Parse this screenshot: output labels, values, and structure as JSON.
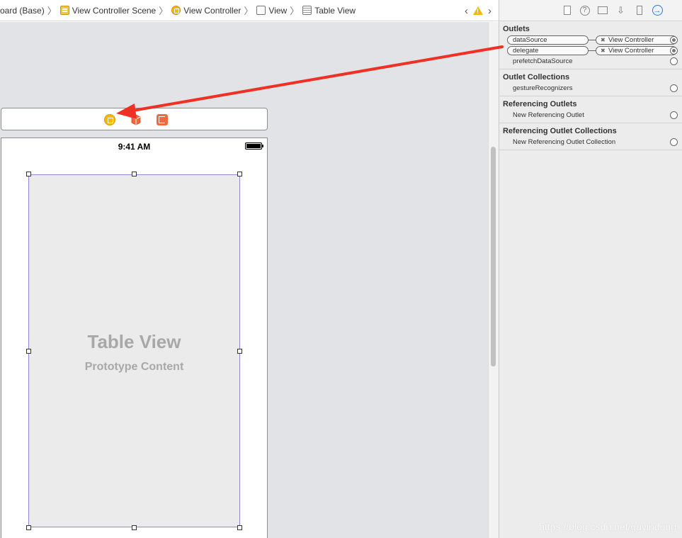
{
  "breadcrumb": {
    "items": [
      {
        "label": "oard (Base)",
        "icon": "none"
      },
      {
        "label": "View Controller Scene",
        "icon": "scene-icon"
      },
      {
        "label": "View Controller",
        "icon": "view-controller-icon"
      },
      {
        "label": "View",
        "icon": "view-icon"
      },
      {
        "label": "Table View",
        "icon": "table-view-icon"
      }
    ]
  },
  "canvas": {
    "status_time": "9:41 AM",
    "table_title": "Table View",
    "table_subtitle": "Prototype Content"
  },
  "inspector": {
    "outlets": {
      "title": "Outlets",
      "rows": [
        {
          "name": "dataSource",
          "target": "View Controller",
          "connected": true
        },
        {
          "name": "delegate",
          "target": "View Controller",
          "connected": true
        },
        {
          "name": "prefetchDataSource",
          "target": "",
          "connected": false
        }
      ]
    },
    "outlet_collections": {
      "title": "Outlet Collections",
      "rows": [
        {
          "name": "gestureRecognizers"
        }
      ]
    },
    "referencing_outlets": {
      "title": "Referencing Outlets",
      "rows": [
        {
          "name": "New Referencing Outlet"
        }
      ]
    },
    "referencing_outlet_collections": {
      "title": "Referencing Outlet Collections",
      "rows": [
        {
          "name": "New Referencing Outlet Collection"
        }
      ]
    }
  },
  "watermark": "https://blog.csdn.net/guyindong",
  "colors": {
    "accent": "#1d7bf5",
    "arrow": "#ee3124",
    "vc_icon": "#f4b90a"
  }
}
